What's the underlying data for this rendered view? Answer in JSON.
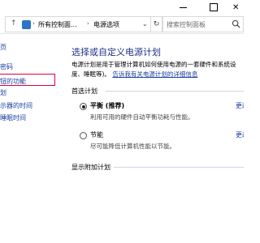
{
  "window": {
    "close_glyph": "✕"
  },
  "address": {
    "breadcrumbs": [
      {
        "label": "所有控制面..."
      },
      {
        "label": "电源选项"
      }
    ],
    "separator": "›",
    "dropdown_glyph": "⌄",
    "refresh_glyph": "↻",
    "up_glyph": "↑",
    "search_placeholder": "搜索控制面板"
  },
  "sidebar": {
    "items": [
      {
        "label": "页"
      },
      {
        "label": "密码"
      },
      {
        "label": "钮的功能"
      },
      {
        "label": "划"
      },
      {
        "label": "示器的时间"
      },
      {
        "label": "睡眠时间"
      }
    ]
  },
  "main": {
    "title": "选择或自定义电源计划",
    "description_line1": "电源计划是用于管理计算机如何使用电源的一套硬件和系统设",
    "description_line2_prefix": "度、睡眠等)。",
    "description_link": "告诉我有关电源计划的详细信息",
    "preferred_section": "首选计划",
    "plans": [
      {
        "name": "平衡 (推荐)",
        "description": "利用可用的硬件自动平衡功耗与性能。",
        "selected": true,
        "change_link": "更改计划设置"
      },
      {
        "name": "节能",
        "description": "尽可能降低计算机性能以节能。",
        "selected": false,
        "change_link": "更改计划设置"
      }
    ],
    "hidden_plans_label": "显示附加计划"
  },
  "colors": {
    "link": "#1a3e9e",
    "title": "#1e3287",
    "highlight_box": "#e0003c"
  }
}
